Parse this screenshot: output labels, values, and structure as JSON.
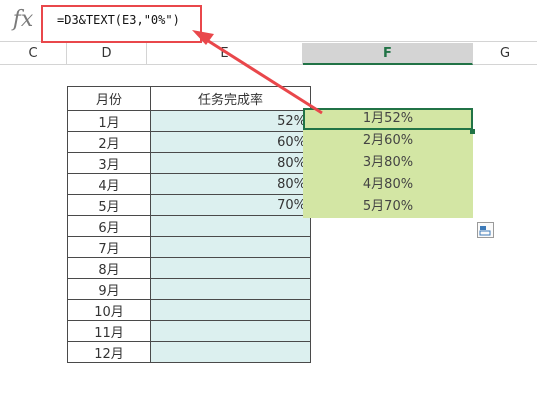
{
  "formula_bar": {
    "fx_label": "fx",
    "formula": "=D3&TEXT(E3,\"0%\")"
  },
  "column_headers": [
    {
      "label": "C",
      "selected": false
    },
    {
      "label": "D",
      "selected": false
    },
    {
      "label": "E",
      "selected": false
    },
    {
      "label": "F",
      "selected": true
    },
    {
      "label": "G",
      "selected": false
    }
  ],
  "table": {
    "headers": [
      "月份",
      "任务完成率"
    ],
    "rows": [
      {
        "month": "1月",
        "rate": "52%"
      },
      {
        "month": "2月",
        "rate": "60%"
      },
      {
        "month": "3月",
        "rate": "80%"
      },
      {
        "month": "4月",
        "rate": "80%"
      },
      {
        "month": "5月",
        "rate": "70%"
      },
      {
        "month": "6月",
        "rate": ""
      },
      {
        "month": "7月",
        "rate": ""
      },
      {
        "month": "8月",
        "rate": ""
      },
      {
        "month": "9月",
        "rate": ""
      },
      {
        "month": "10月",
        "rate": ""
      },
      {
        "month": "11月",
        "rate": ""
      },
      {
        "month": "12月",
        "rate": ""
      }
    ]
  },
  "results": [
    "1月52%",
    "2月60%",
    "3月80%",
    "4月80%",
    "5月70%"
  ],
  "colors": {
    "highlight_red": "#e9474b",
    "result_fill": "#d3e6a4",
    "rate_fill": "#dcf0ef",
    "selection_green": "#217346"
  }
}
